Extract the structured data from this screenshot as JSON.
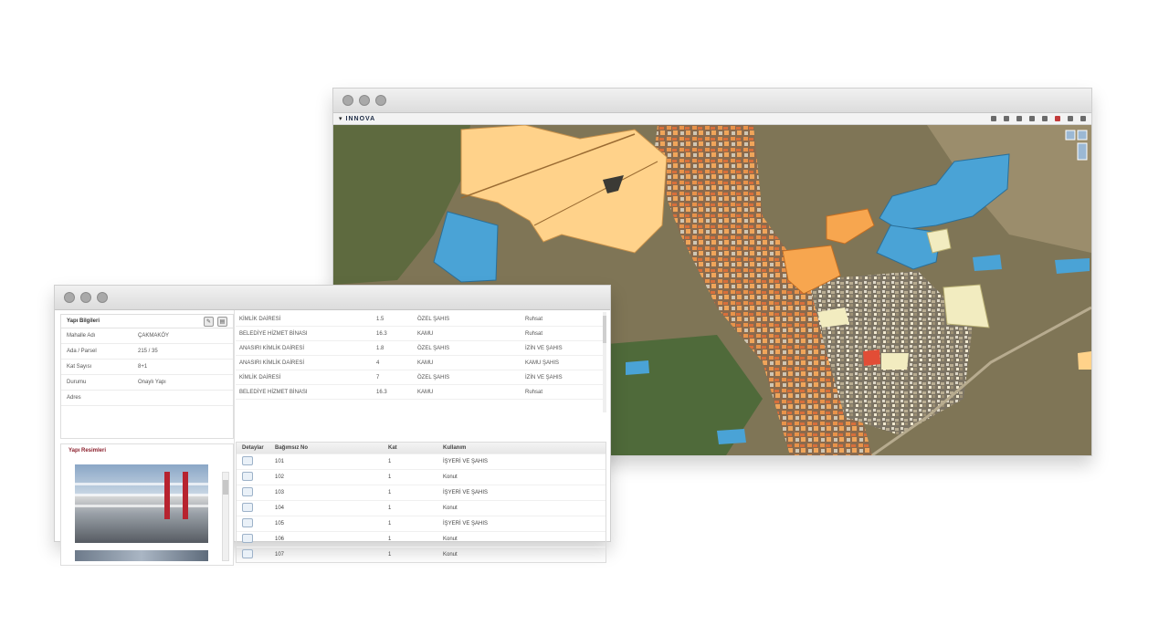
{
  "map_window": {
    "toolbar": {
      "logo": "INNOVA"
    },
    "colors": {
      "residential_orange": "#f7a64f",
      "parcel_yellow": "#ffd28a",
      "parcel_blue": "#4aa3d6",
      "parcel_cream": "#f2ecc0",
      "building_red": "#e24d36",
      "terrain": "#8a7d5b"
    }
  },
  "data_window": {
    "info_panel": {
      "title": "Yapı Bilgileri",
      "rows": [
        {
          "key": "Mahalle Adı",
          "value": "ÇAKMAKÖY"
        },
        {
          "key": "Ada / Parsel",
          "value": "215 / 35"
        },
        {
          "key": "Kat Sayısı",
          "value": "8+1"
        },
        {
          "key": "Durumu",
          "value": "Onaylı Yapı"
        },
        {
          "key": "Adres",
          "value": ""
        }
      ]
    },
    "photo_panel": {
      "title": "Yapı Resimleri"
    },
    "attributes": [
      [
        "KİMLİK DAİRESİ",
        "1.5",
        "ÖZEL ŞAHIS",
        "Ruhsat"
      ],
      [
        "BELEDİYE HİZMET BİNASI",
        "16.3",
        "KAMU",
        "Ruhsat"
      ],
      [
        "ANASIRI KİMLİK DAİRESİ",
        "1.8",
        "ÖZEL ŞAHIS",
        "İZİN VE ŞAHIS"
      ],
      [
        "ANASIRI KİMLİK DAİRESİ",
        "4",
        "KAMU",
        "KAMU ŞAHIS"
      ],
      [
        "KİMLİK DAİRESİ",
        "7",
        "ÖZEL ŞAHIS",
        "İZİN VE ŞAHIS"
      ],
      [
        "BELEDİYE HİZMET BİNASI",
        "16.3",
        "KAMU",
        "Ruhsat"
      ]
    ],
    "list": {
      "headers": [
        "Detaylar",
        "Bağımsız No",
        "Kat",
        "Kullanım"
      ],
      "rows": [
        [
          "",
          "101",
          "1",
          "İŞYERİ VE ŞAHIS"
        ],
        [
          "",
          "102",
          "1",
          "Konut"
        ],
        [
          "",
          "103",
          "1",
          "İŞYERİ VE ŞAHIS"
        ],
        [
          "",
          "104",
          "1",
          "Konut"
        ],
        [
          "",
          "105",
          "1",
          "İŞYERİ VE ŞAHIS"
        ],
        [
          "",
          "106",
          "1",
          "Konut"
        ],
        [
          "",
          "107",
          "1",
          "Konut"
        ]
      ]
    }
  }
}
